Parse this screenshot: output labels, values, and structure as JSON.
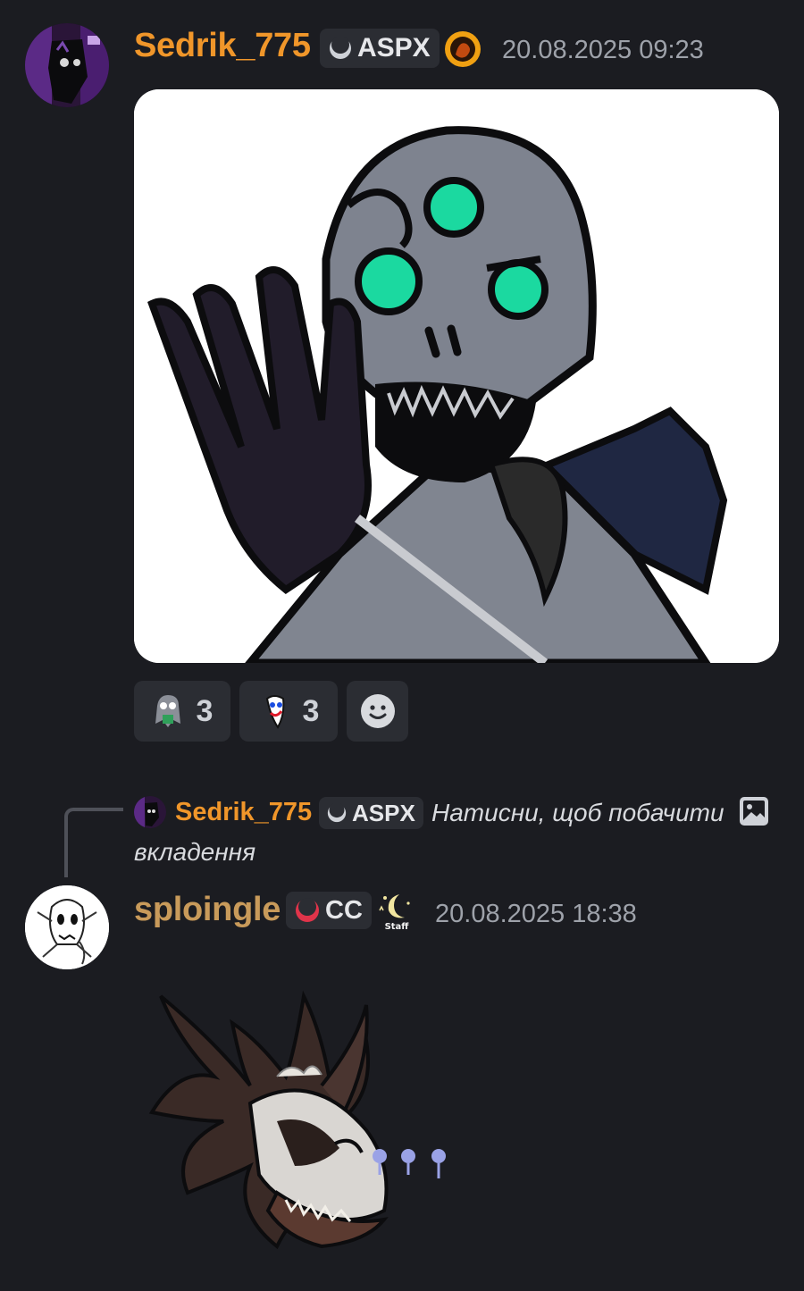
{
  "messages": [
    {
      "username": "Sedrik_775",
      "name_color": "#f0962a",
      "tag_label": "ASPX",
      "tag_icon": "moon-icon",
      "badge_icon": "fire-orb-icon",
      "timestamp": "20.08.2025 09:23",
      "attachment": "image-creature-drawing",
      "reactions": [
        {
          "emoji": "ghost-sticker-icon",
          "count": "3"
        },
        {
          "emoji": "clown-sticker-icon",
          "count": "3"
        }
      ],
      "add_reaction_icon": "smiley-add-icon"
    },
    {
      "reply_to": {
        "username": "Sedrik_775",
        "tag_label": "ASPX",
        "text": "Натисни, щоб побачити вкладення",
        "text_line1": "Натисни, щоб побачити",
        "text_line2": "вкладення",
        "attachment_icon": "image-icon"
      },
      "username": "sploingle",
      "name_color": "#c89a5a",
      "tag_label": "CC",
      "tag_icon": "red-moon-icon",
      "badge_icon": "staff-badge-icon",
      "badge_text": "Staff",
      "timestamp": "20.08.2025 18:38",
      "attachment": "sticker-skull-creature"
    }
  ]
}
